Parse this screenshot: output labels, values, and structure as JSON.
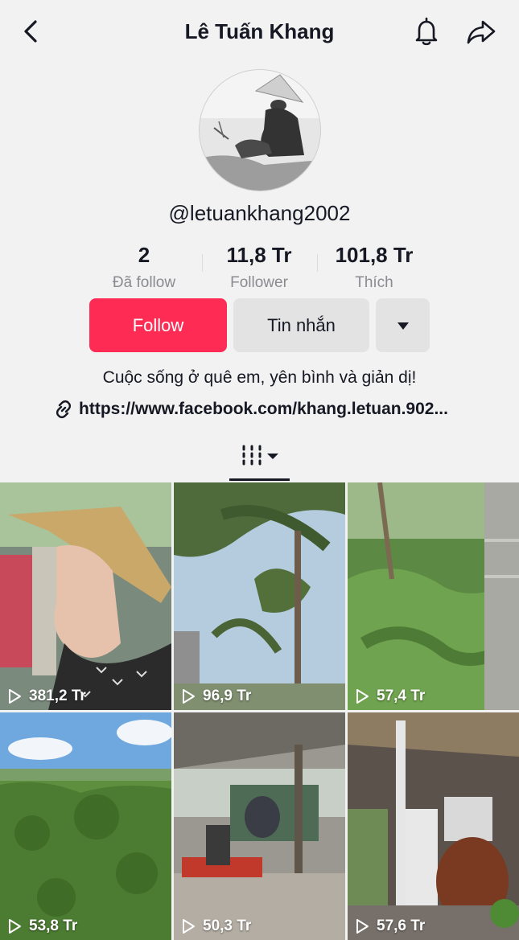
{
  "header": {
    "title": "Lê Tuấn Khang"
  },
  "profile": {
    "username": "@letuankhang2002",
    "bio": "Cuộc sống ở quê em, yên bình và giản dị!",
    "link": "https://www.facebook.com/khang.letuan.902..."
  },
  "stats": [
    {
      "value": "2",
      "label": "Đã follow"
    },
    {
      "value": "11,8 Tr",
      "label": "Follower"
    },
    {
      "value": "101,8 Tr",
      "label": "Thích"
    }
  ],
  "buttons": {
    "follow": "Follow",
    "message": "Tin nhắn"
  },
  "colors": {
    "accent": "#fe2c55",
    "button_gray": "#e3e3e4",
    "background": "#f2f2f2"
  },
  "icons": {
    "back": "chevron-left-icon",
    "bell": "bell-icon",
    "share": "share-arrow-icon",
    "more": "caret-down-icon",
    "link": "link-icon",
    "videos_tab": "grid-tab-icon",
    "views": "play-outline-icon"
  },
  "videos": [
    {
      "views": "381,2 Tr"
    },
    {
      "views": "96,9 Tr"
    },
    {
      "views": "57,4 Tr"
    },
    {
      "views": "53,8 Tr"
    },
    {
      "views": "50,3 Tr"
    },
    {
      "views": "57,6 Tr"
    }
  ]
}
